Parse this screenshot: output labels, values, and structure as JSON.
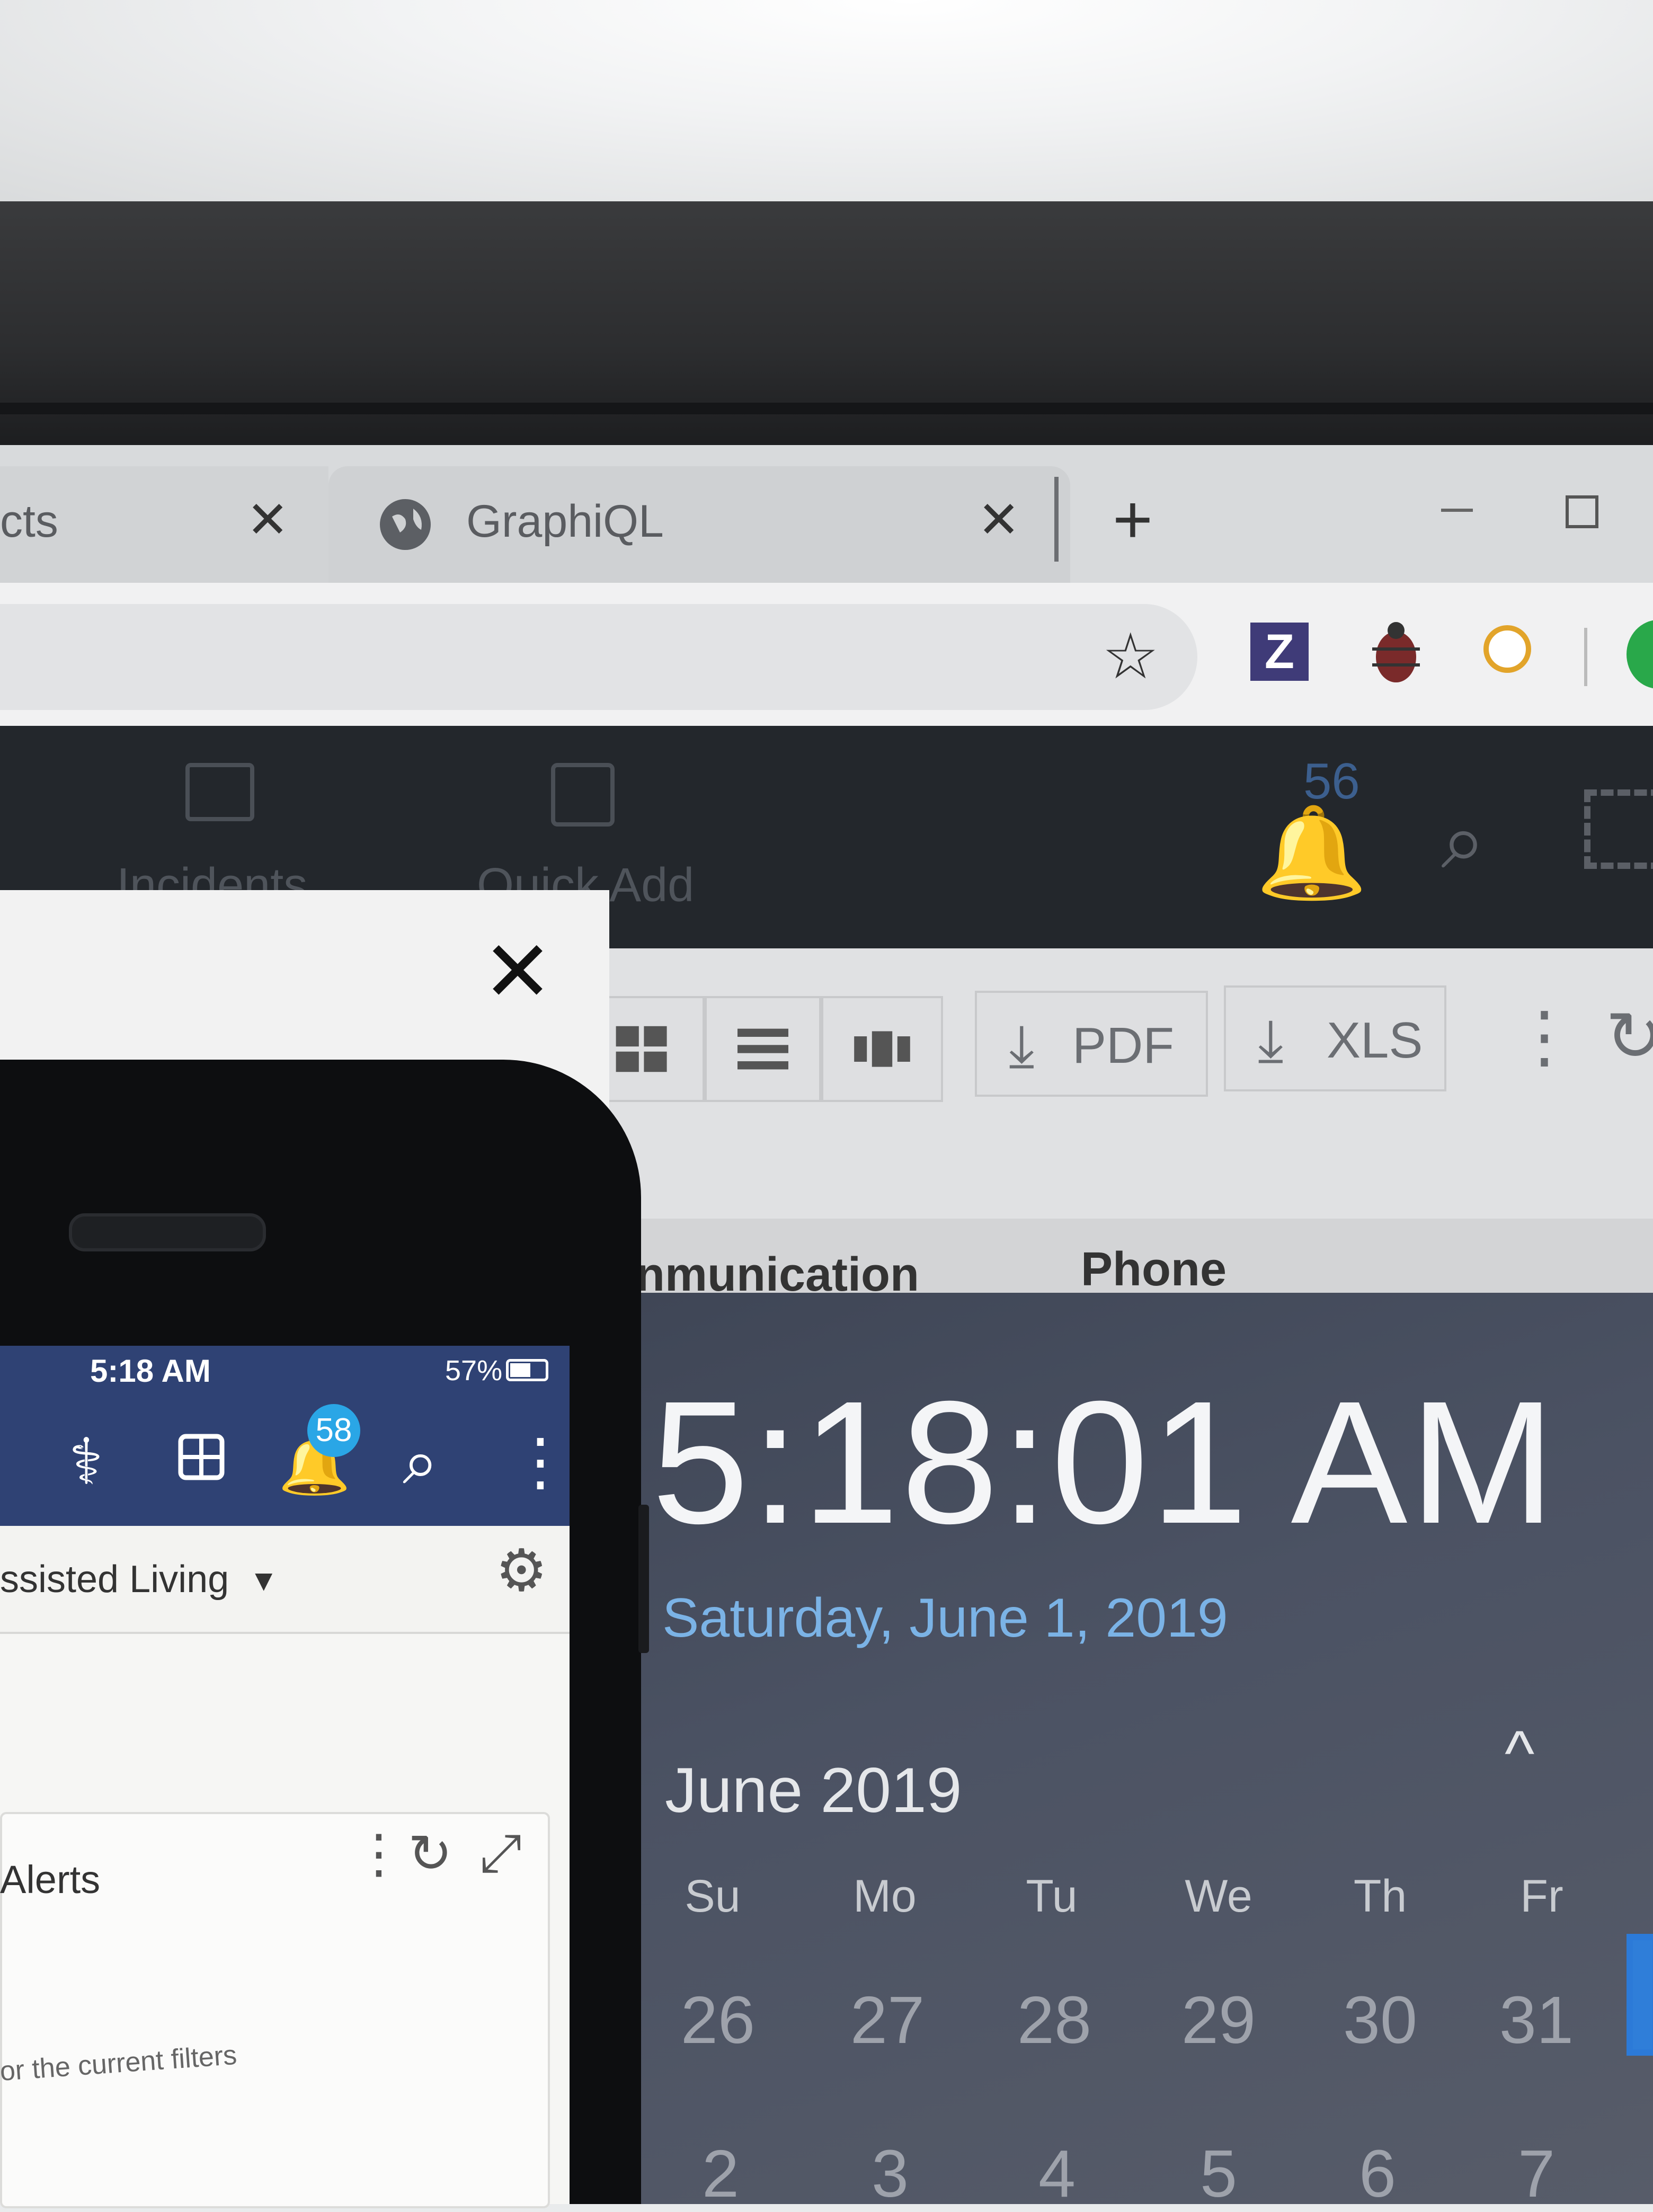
{
  "browser": {
    "tabs": [
      {
        "title": "cts",
        "close": "✕"
      },
      {
        "title": "GraphiQL",
        "close": "✕"
      }
    ],
    "new_tab": "+",
    "star_icon": "☆",
    "extensions": [
      {
        "name": "z-extension-icon",
        "label": "Z",
        "color": "#3f3b78"
      },
      {
        "name": "bug-extension-icon"
      },
      {
        "name": "compass-extension-icon",
        "color": "#e2a42a"
      },
      {
        "name": "profile-avatar-icon",
        "color": "#29a84a"
      }
    ]
  },
  "app": {
    "header": {
      "incidents_label": "Incidents",
      "quick_add_label": "Quick Add",
      "notifications_count": "56",
      "icons": [
        "incidents-icon",
        "quick-add-icon",
        "bell-icon",
        "search-icon",
        "expand-icon"
      ]
    },
    "toolbar": {
      "pdf_label": "PDF",
      "xls_label": "XLS",
      "more": "⋮",
      "refresh": "↻"
    },
    "columns": {
      "communication": "nmunication",
      "phone": "Phone"
    },
    "modal": {
      "close": "✕"
    }
  },
  "clock": {
    "time": "5:18:01 AM",
    "date": "Saturday, June 1, 2019",
    "accent": "#7bb3e6",
    "calendar": {
      "month": "June 2019",
      "nav_up": "^",
      "weekdays": [
        "Su",
        "Mo",
        "Tu",
        "We",
        "Th",
        "Fr"
      ],
      "weeks": [
        [
          "26",
          "27",
          "28",
          "29",
          "30",
          "31"
        ],
        [
          "2",
          "3",
          "4",
          "5",
          "6",
          "7"
        ]
      ]
    }
  },
  "phone": {
    "status": {
      "time": "5:18 AM",
      "battery": "57%"
    },
    "nav": {
      "icons": [
        "stethoscope-icon",
        "add-icon",
        "bell-icon",
        "search-icon",
        "more-icon"
      ],
      "badge": "58"
    },
    "facility": "ssisted Living",
    "widget": {
      "title": "Alerts",
      "empty_text": "or the current filters"
    },
    "brand_color": "#2f4274"
  }
}
